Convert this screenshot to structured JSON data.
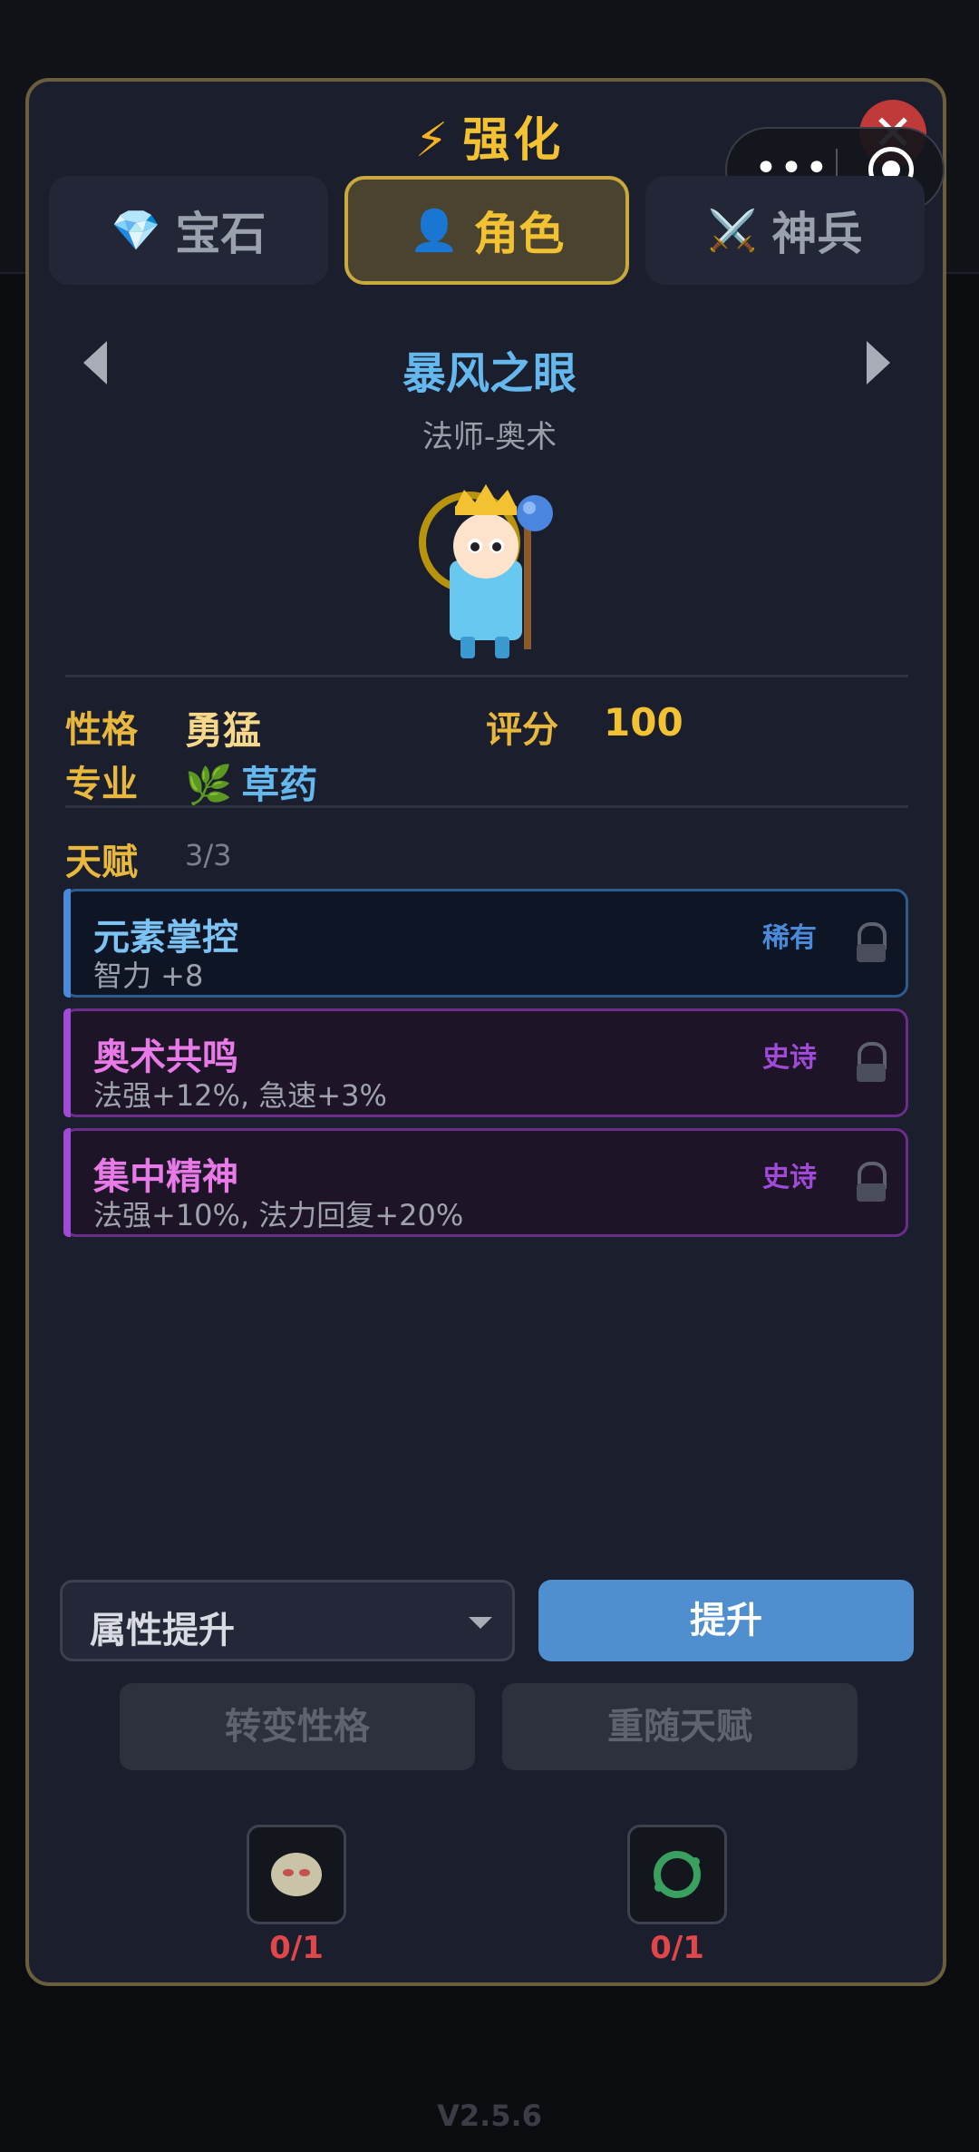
{
  "header": {
    "title": "强化",
    "title_icon": "lightning-icon",
    "close_icon": "close-icon",
    "menu_icon": "more-dots-icon",
    "record_icon": "target-icon"
  },
  "tabs": [
    {
      "label": "宝石",
      "icon": "gem-icon",
      "active": false
    },
    {
      "label": "角色",
      "icon": "person-icon",
      "active": true
    },
    {
      "label": "神兵",
      "icon": "crossed-swords-icon",
      "active": false
    }
  ],
  "hero": {
    "name": "暴风之眼",
    "class": "法师-奥术"
  },
  "stats": {
    "personality_label": "性格",
    "personality_value": "勇猛",
    "score_label": "评分",
    "score_value": "100",
    "profession_label": "专业",
    "profession_icon": "herb-icon",
    "profession_value": "草药"
  },
  "talents": {
    "label": "天赋",
    "count": "3/3",
    "items": [
      {
        "name": "元素掌控",
        "desc": "智力 +8",
        "rarity": "稀有"
      },
      {
        "name": "奥术共鸣",
        "desc": "法强+12%, 急速+3%",
        "rarity": "史诗"
      },
      {
        "name": "集中精神",
        "desc": "法强+10%, 法力回复+20%",
        "rarity": "史诗"
      }
    ]
  },
  "actions": {
    "select_value": "属性提升",
    "upgrade_label": "提升",
    "change_personality_label": "转变性格",
    "reroll_talent_label": "重随天赋"
  },
  "items": [
    {
      "icon": "egg-item-icon",
      "count": "0/1"
    },
    {
      "icon": "green-ring-item-icon",
      "count": "0/1"
    }
  ],
  "version": "V2.5.6",
  "colors": {
    "accent_gold": "#f2c232",
    "rare_blue": "#4a8ad8",
    "epic_purple": "#a24ad8",
    "upgrade_button": "#4f8fd0",
    "count_red": "#e0464a"
  }
}
